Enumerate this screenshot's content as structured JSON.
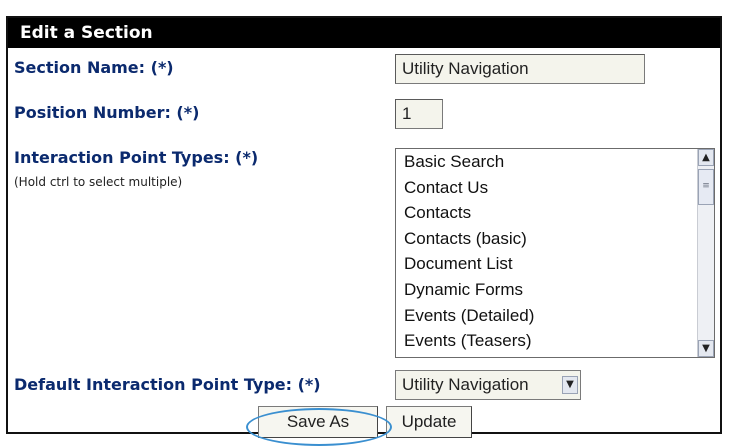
{
  "header": {
    "title": "Edit a Section"
  },
  "section_name": {
    "label": "Section Name: (*)",
    "value": "Utility Navigation"
  },
  "position_number": {
    "label": "Position Number: (*)",
    "value": "1"
  },
  "interaction_point_types": {
    "label": "Interaction Point Types: (*)",
    "hint": "(Hold ctrl to select multiple)",
    "options": [
      "Basic Search",
      "Contact Us",
      "Contacts",
      "Contacts (basic)",
      "Document List",
      "Dynamic Forms",
      "Events (Detailed)",
      "Events (Teasers)"
    ],
    "icons": {
      "scroll_up": "scroll-up-arrow-icon",
      "scroll_down": "scroll-down-arrow-icon",
      "thumb": "scroll-thumb-grip-icon"
    }
  },
  "default_type": {
    "label": "Default Interaction Point Type: (*)",
    "value": "Utility Navigation",
    "icon": "chevron-down-icon"
  },
  "buttons": {
    "save_as": "Save As",
    "update": "Update"
  },
  "colors": {
    "label": "#0b2a6e",
    "header_bg": "#000000",
    "highlight": "#3a8fd0"
  }
}
